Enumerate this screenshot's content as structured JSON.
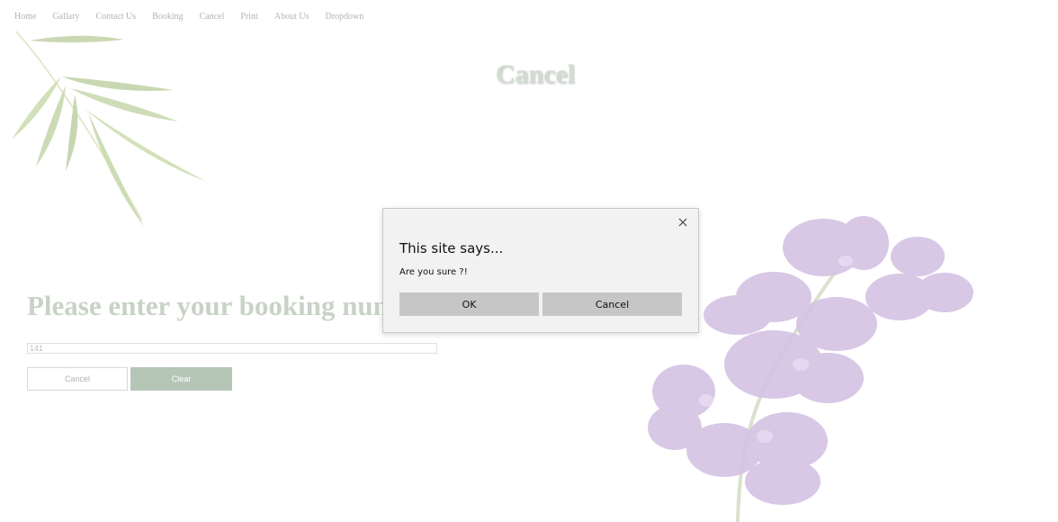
{
  "nav": {
    "items": [
      "Home",
      "Gallary",
      "Contact Us",
      "Booking",
      "Cancel",
      "Print",
      "About Us",
      "Dropdown"
    ]
  },
  "page": {
    "title": "Cancel",
    "prompt": "Please enter your booking number",
    "booking_value": "141",
    "cancel_label": "Cancel",
    "clear_label": "Clear"
  },
  "dialog": {
    "heading": "This site says...",
    "message": "Are you sure ?!",
    "ok_label": "OK",
    "cancel_label": "Cancel",
    "close_icon": "close-icon"
  },
  "colors": {
    "title": "#8aa286",
    "prompt": "#6f8d6a",
    "clear_button": "#3d6b3f",
    "dialog_bg": "#f2f2f2",
    "dialog_button": "#c6c6c6"
  }
}
